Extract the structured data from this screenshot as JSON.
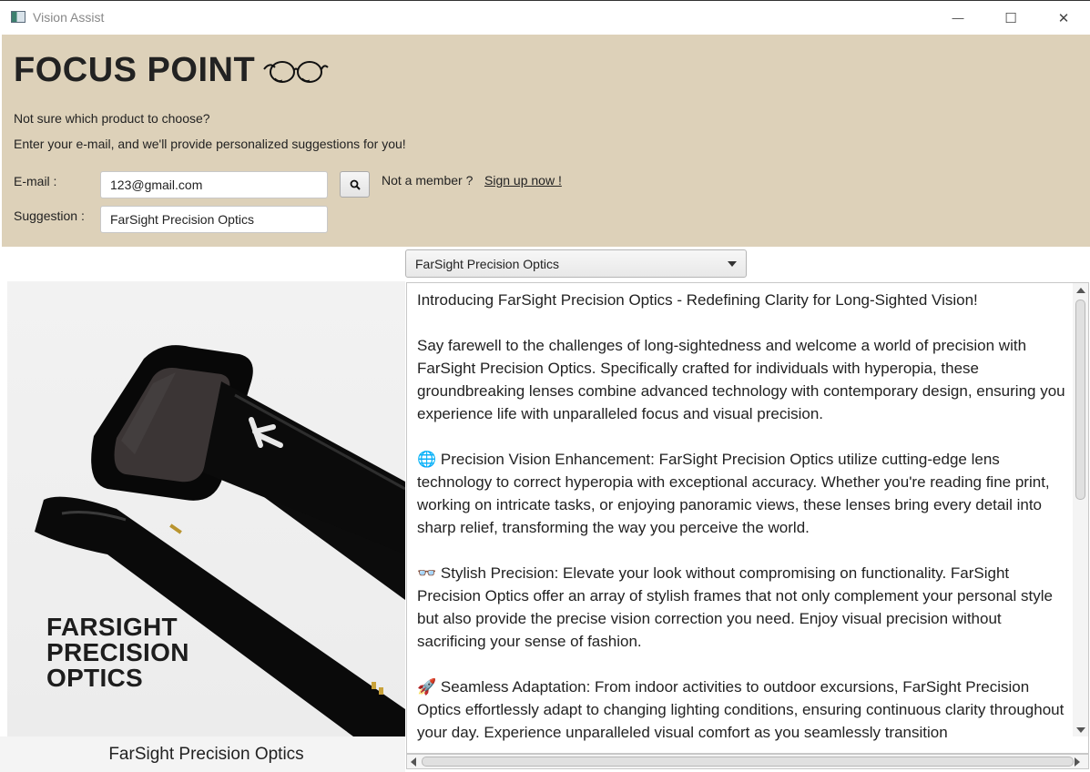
{
  "window": {
    "title": "Vision Assist",
    "minimize_glyph": "—",
    "maximize_glyph": "☐",
    "close_glyph": "✕"
  },
  "header": {
    "brand": "FOCUS POINT",
    "brand_icon": "glasses-icon",
    "line1": "Not sure which product to choose?",
    "line2": "Enter your e-mail, and we'll provide personalized suggestions for you!",
    "email_label": "E-mail :",
    "email_value": "123@gmail.com",
    "suggestion_label": "Suggestion :",
    "suggestion_value": "FarSight Precision Optics",
    "search_icon": "search-icon",
    "member_text": "Not a member ?",
    "signup_link": "Sign up now !",
    "background_color": "#ddd1b9"
  },
  "product_select": {
    "selected": "FarSight Precision Optics"
  },
  "product_image": {
    "caption_lines": [
      "FARSIGHT",
      "PRECISION",
      "OPTICS"
    ]
  },
  "product_name": "FarSight Precision Optics",
  "description": {
    "paragraphs": [
      "Introducing FarSight Precision Optics - Redefining Clarity for Long-Sighted Vision!",
      "Say farewell to the challenges of long-sightedness and welcome a world of precision with FarSight Precision Optics. Specifically crafted for individuals with hyperopia, these groundbreaking lenses combine advanced technology with contemporary design, ensuring you experience life with unparalleled focus and visual precision.",
      "🌐 Precision Vision Enhancement: FarSight Precision Optics utilize cutting-edge lens technology to correct hyperopia with exceptional accuracy. Whether you're reading fine print, working on intricate tasks, or enjoying panoramic views, these lenses bring every detail into sharp relief, transforming the way you perceive the world.",
      "👓 Stylish Precision: Elevate your look without compromising on functionality. FarSight Precision Optics offer an array of stylish frames that not only complement your personal style but also provide the precise vision correction you need. Enjoy visual precision without sacrificing your sense of fashion.",
      "🚀 Seamless Adaptation: From indoor activities to outdoor excursions, FarSight Precision Optics effortlessly adapt to changing lighting conditions, ensuring continuous clarity throughout your day. Experience unparalleled visual comfort as you seamlessly transition"
    ]
  }
}
